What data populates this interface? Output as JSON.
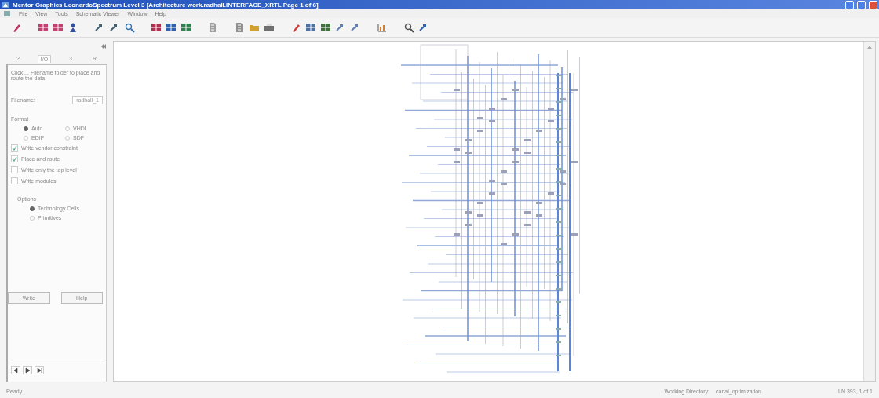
{
  "window": {
    "title": "Mentor Graphics  LeonardoSpectrum Level 3  [Architecture  work.radhall.INTERFACE_XRTL Page 1 of 6]"
  },
  "menu": [
    "File",
    "View",
    "Tools",
    "Schematic Viewer",
    "Window",
    "Help"
  ],
  "toolbar": [
    {
      "kind": "pen",
      "color": "#c03060"
    },
    {
      "kind": "gap"
    },
    {
      "kind": "block",
      "color": "#c04070"
    },
    {
      "kind": "block",
      "color": "#c04070"
    },
    {
      "kind": "person",
      "color": "#3050a0"
    },
    {
      "kind": "gap"
    },
    {
      "kind": "pointer",
      "color": "#406070"
    },
    {
      "kind": "pointer",
      "color": "#406070"
    },
    {
      "kind": "magnifier",
      "color": "#3070b0"
    },
    {
      "kind": "gap"
    },
    {
      "kind": "block",
      "color": "#b03050"
    },
    {
      "kind": "block",
      "color": "#3060b0"
    },
    {
      "kind": "block",
      "color": "#308050"
    },
    {
      "kind": "gap"
    },
    {
      "kind": "page",
      "color": "#a0a0a0"
    },
    {
      "kind": "gap"
    },
    {
      "kind": "page",
      "color": "#909090"
    },
    {
      "kind": "folder",
      "color": "#d0a030"
    },
    {
      "kind": "printer",
      "color": "#707070"
    },
    {
      "kind": "gap"
    },
    {
      "kind": "pen",
      "color": "#d04040"
    },
    {
      "kind": "block",
      "color": "#5070a0"
    },
    {
      "kind": "block",
      "color": "#407040"
    },
    {
      "kind": "pointer",
      "color": "#6080b0"
    },
    {
      "kind": "pointer",
      "color": "#6080b0"
    },
    {
      "kind": "gap"
    },
    {
      "kind": "chart",
      "color": "#d08030"
    },
    {
      "kind": "gap"
    },
    {
      "kind": "magnifier",
      "color": "#505050"
    },
    {
      "kind": "pointer",
      "color": "#3060b0"
    }
  ],
  "panel": {
    "tabs": [
      {
        "label": "?",
        "selected": false
      },
      {
        "label": "I/O",
        "selected": true
      },
      {
        "label": "3",
        "selected": false
      },
      {
        "label": "R",
        "selected": false
      }
    ],
    "intro": "Click ... Filename folder to place and route the data",
    "filename_label": "Filename:",
    "filename": "radhall_1",
    "format_label": "Format",
    "formats": [
      {
        "label": "Auto",
        "selected": true
      },
      {
        "label": "VHDL",
        "selected": false
      },
      {
        "label": "EDIF",
        "selected": false
      },
      {
        "label": "SDF",
        "selected": false
      }
    ],
    "options": [
      {
        "label": "Write vendor constraint",
        "checked": true
      },
      {
        "label": "Place and route",
        "checked": true
      },
      {
        "label": "Write only the top level",
        "checked": false
      },
      {
        "label": "Write modules",
        "checked": false
      }
    ],
    "group_label": "Options",
    "cells": [
      {
        "label": "Technology Cells",
        "selected": true
      },
      {
        "label": "Primitives",
        "selected": false
      }
    ],
    "buttons": [
      "Write",
      "Help"
    ]
  },
  "status_bar": {
    "message": "Ready",
    "working_directory_label": "Working Directory:",
    "working_directory": "canal_optimization",
    "position": "LN 393, 1 of 1"
  }
}
